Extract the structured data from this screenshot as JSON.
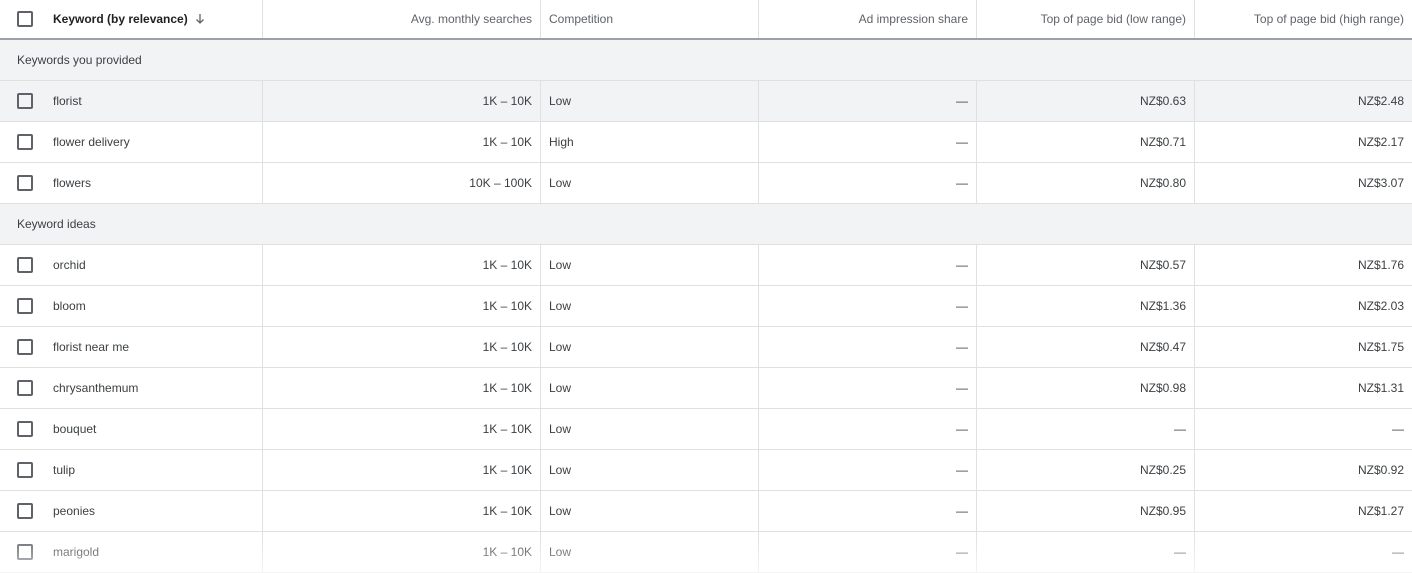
{
  "table": {
    "headers": {
      "keyword": "Keyword (by relevance)",
      "avg_monthly_searches": "Avg. monthly searches",
      "competition": "Competition",
      "ad_impression_share": "Ad impression share",
      "bid_low": "Top of page bid (low range)",
      "bid_high": "Top of page bid (high range)"
    },
    "sort": {
      "column": "keyword",
      "direction": "descending",
      "icon": "arrow-down-icon"
    },
    "sections": [
      {
        "title": "Keywords you provided",
        "rows": [
          {
            "keyword": "florist",
            "avg": "1K – 10K",
            "competition": "Low",
            "impression": "—",
            "low": "NZ$0.63",
            "high": "NZ$2.48",
            "hovered": true
          },
          {
            "keyword": "flower delivery",
            "avg": "1K – 10K",
            "competition": "High",
            "impression": "—",
            "low": "NZ$0.71",
            "high": "NZ$2.17"
          },
          {
            "keyword": "flowers",
            "avg": "10K – 100K",
            "competition": "Low",
            "impression": "—",
            "low": "NZ$0.80",
            "high": "NZ$3.07"
          }
        ]
      },
      {
        "title": "Keyword ideas",
        "rows": [
          {
            "keyword": "orchid",
            "avg": "1K – 10K",
            "competition": "Low",
            "impression": "—",
            "low": "NZ$0.57",
            "high": "NZ$1.76"
          },
          {
            "keyword": "bloom",
            "avg": "1K – 10K",
            "competition": "Low",
            "impression": "—",
            "low": "NZ$1.36",
            "high": "NZ$2.03"
          },
          {
            "keyword": "florist near me",
            "avg": "1K – 10K",
            "competition": "Low",
            "impression": "—",
            "low": "NZ$0.47",
            "high": "NZ$1.75"
          },
          {
            "keyword": "chrysanthemum",
            "avg": "1K – 10K",
            "competition": "Low",
            "impression": "—",
            "low": "NZ$0.98",
            "high": "NZ$1.31"
          },
          {
            "keyword": "bouquet",
            "avg": "1K – 10K",
            "competition": "Low",
            "impression": "—",
            "low": "—",
            "high": "—"
          },
          {
            "keyword": "tulip",
            "avg": "1K – 10K",
            "competition": "Low",
            "impression": "—",
            "low": "NZ$0.25",
            "high": "NZ$0.92"
          },
          {
            "keyword": "peonies",
            "avg": "1K – 10K",
            "competition": "Low",
            "impression": "—",
            "low": "NZ$0.95",
            "high": "NZ$1.27"
          },
          {
            "keyword": "marigold",
            "avg": "1K – 10K",
            "competition": "Low",
            "impression": "—",
            "low": "—",
            "high": "—"
          }
        ]
      }
    ]
  }
}
